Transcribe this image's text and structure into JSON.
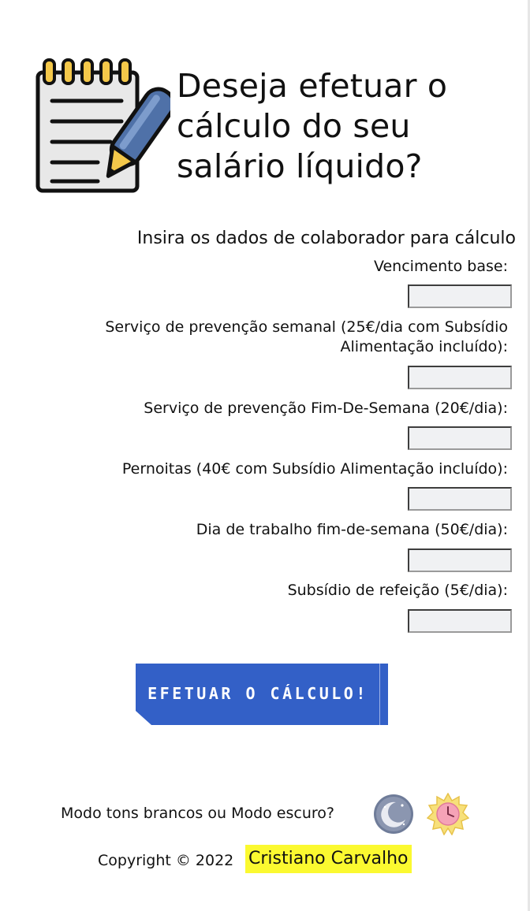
{
  "header": {
    "title": "Deseja efetuar o cálculo do seu salário líquido?",
    "icon": "notepad-pen-icon"
  },
  "form": {
    "subtitle": "Insira os dados de colaborador para cálculo",
    "fields": [
      {
        "label": "Vencimento base:",
        "value": ""
      },
      {
        "label": "Serviço de prevenção semanal (25€/dia com Subsídio Alimentação incluído):",
        "value": ""
      },
      {
        "label": "Serviço de prevenção Fim-De-Semana (20€/dia):",
        "value": ""
      },
      {
        "label": "Pernoitas (40€ com Subsídio Alimentação incluído):",
        "value": ""
      },
      {
        "label": "Dia de trabalho fim-de-semana (50€/dia):",
        "value": ""
      },
      {
        "label": "Subsídio de refeição (5€/dia):",
        "value": ""
      }
    ],
    "submit_label": "EFETUAR O CÁLCULO!"
  },
  "theme": {
    "prompt": "Modo tons brancos ou Modo escuro?",
    "dark_icon": "moon-icon",
    "light_icon": "sun-icon"
  },
  "footer": {
    "copyright": "Copyright © 2022",
    "author": "Cristiano Carvalho"
  },
  "colors": {
    "button": "#3360c7",
    "author_highlight": "#fbf930",
    "input_background": "#f0f1f3"
  }
}
